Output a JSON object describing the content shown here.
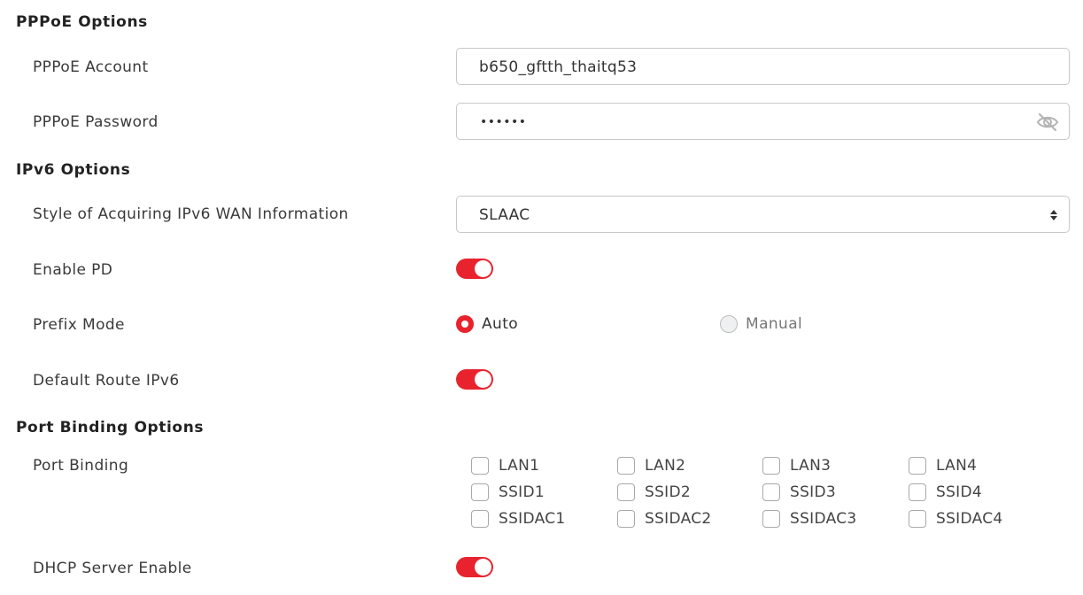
{
  "pppoe": {
    "title": "PPPoE Options",
    "account_label": "PPPoE Account",
    "account_value": "b650_gftth_thaitq53",
    "password_label": "PPPoE Password",
    "password_masked": "••••••",
    "password_toggle_icon": "eye-slash-icon"
  },
  "ipv6": {
    "title": "IPv6 Options",
    "style_label": "Style of Acquiring IPv6 WAN Information",
    "style_value": "SLAAC",
    "enable_pd_label": "Enable PD",
    "enable_pd_on": true,
    "prefix_mode_label": "Prefix Mode",
    "prefix_auto_label": "Auto",
    "prefix_manual_label": "Manual",
    "prefix_selected": "Auto",
    "default_route_label": "Default Route IPv6",
    "default_route_on": true
  },
  "port_binding": {
    "title": "Port Binding Options",
    "label": "Port Binding",
    "rows": [
      [
        "LAN1",
        "LAN2",
        "LAN3",
        "LAN4"
      ],
      [
        "SSID1",
        "SSID2",
        "SSID3",
        "SSID4"
      ],
      [
        "SSIDAC1",
        "SSIDAC2",
        "SSIDAC3",
        "SSIDAC4"
      ]
    ],
    "checked": []
  },
  "dhcp": {
    "label": "DHCP Server Enable",
    "on": true
  },
  "colors": {
    "accent": "#e8232e",
    "border": "#c8c8c8"
  }
}
